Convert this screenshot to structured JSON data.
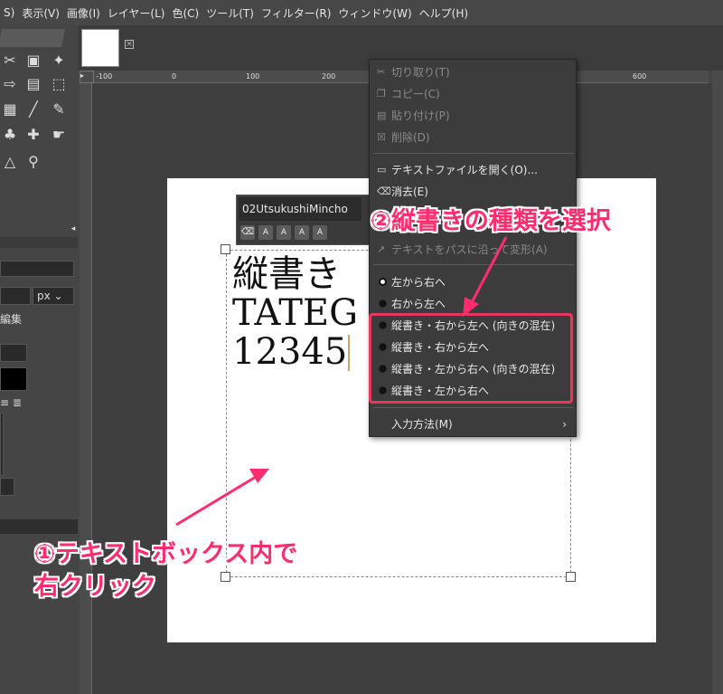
{
  "menubar": {
    "items": [
      "S)",
      "表示(V)",
      "画像(I)",
      "レイヤー(L)",
      "色(C)",
      "ツール(T)",
      "フィルター(R)",
      "ウィンドウ(W)",
      "ヘルプ(H)"
    ]
  },
  "toolbox": {
    "unit": "px",
    "edit_label": "編集"
  },
  "ruler": {
    "top_labels": [
      "-100",
      "0",
      "100",
      "200",
      "600"
    ],
    "left_labels": [
      "1",
      "0",
      "0",
      "2",
      "0",
      "0",
      "3",
      "0",
      "0",
      "4",
      "0",
      "0",
      "5",
      "0",
      "0",
      "6",
      "0",
      "0",
      "7",
      "0",
      "0"
    ]
  },
  "text_bar": {
    "font_name": "02UtsukushiMincho",
    "style_buttons": [
      "A",
      "A",
      "A",
      "A"
    ]
  },
  "canvas_text": {
    "lines": [
      "縦書き",
      "TATEG",
      "12345"
    ]
  },
  "context_menu": {
    "items": [
      {
        "label": "切り取り(T)",
        "icon": "scissors-icon",
        "disabled": true
      },
      {
        "label": "コピー(C)",
        "icon": "copy-icon",
        "disabled": true
      },
      {
        "label": "貼り付け(P)",
        "icon": "paste-icon",
        "disabled": true
      },
      {
        "label": "削除(D)",
        "icon": "delete-icon",
        "disabled": true
      },
      {
        "label": "テキストファイルを開く(O)...",
        "icon": "open-file-icon",
        "disabled": false
      },
      {
        "label": "消去(E)",
        "icon": "clear-icon",
        "disabled": false
      },
      {
        "label": "テキストをパスに沿って変形(A)",
        "icon": "text-along-path-icon",
        "disabled": true
      }
    ],
    "direction_options": [
      {
        "label": "左から右へ",
        "checked": true
      },
      {
        "label": "右から左へ",
        "checked": false
      },
      {
        "label": "縦書き・右から左へ (向きの混在)",
        "checked": false
      },
      {
        "label": "縦書き・右から左へ",
        "checked": false
      },
      {
        "label": "縦書き・左から右へ (向きの混在)",
        "checked": false
      },
      {
        "label": "縦書き・左から右へ",
        "checked": false
      }
    ],
    "input_method": "入力方法(M)"
  },
  "annotations": {
    "step2": "②縦書きの種類を選択",
    "step1_line1": "①テキストボックス内で",
    "step1_line2": "右クリック",
    "color": "#ff2d6e"
  }
}
